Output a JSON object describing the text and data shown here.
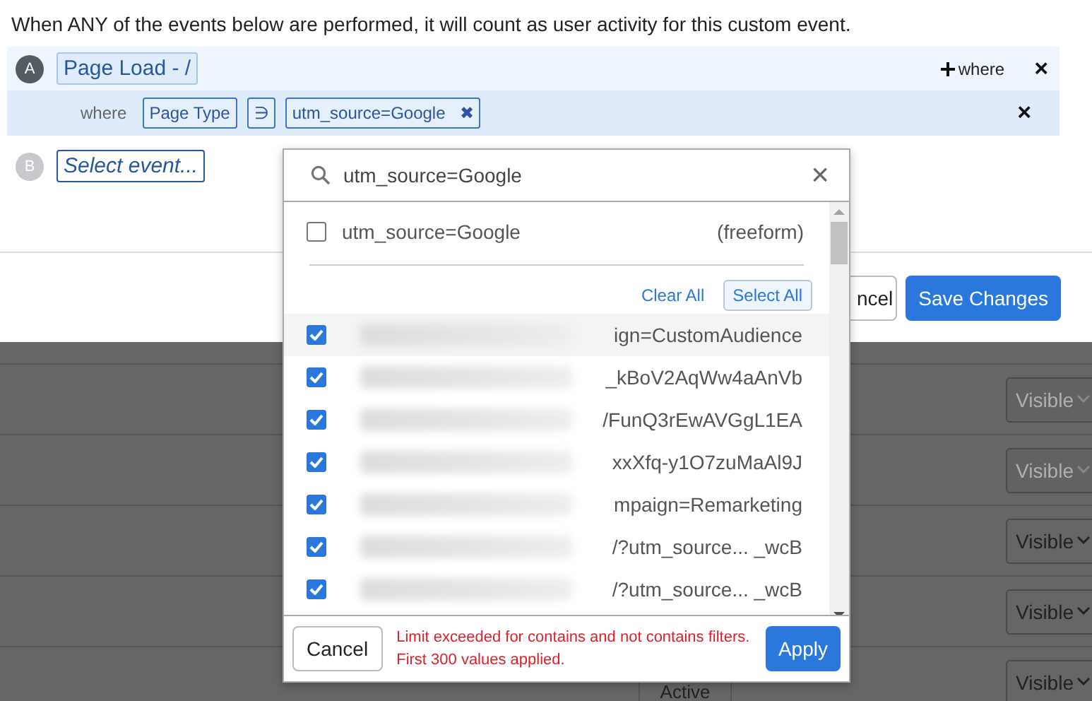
{
  "intro": "When ANY of the events below are performed, it will count as user activity for this custom event.",
  "events": [
    {
      "letter": "A",
      "kind": "set",
      "name": "Page Load - /",
      "add_where": "where",
      "remove": "×",
      "filters": [
        {
          "prefix": "where",
          "property": "Page Type",
          "operator": "∋",
          "values": [
            {
              "label": "utm_source=Google",
              "remove": "✖"
            }
          ],
          "remove": "×"
        }
      ]
    },
    {
      "letter": "B",
      "kind": "empty",
      "name": "Select event..."
    }
  ],
  "footer_buttons": [
    {
      "label": "ncel",
      "kind": "secondary"
    },
    {
      "label": "Save Changes",
      "kind": "primary"
    }
  ],
  "background_rows": [
    {
      "status": "Visible",
      "disabled": true
    },
    {
      "status": "Visible",
      "disabled": true
    },
    {
      "status": "Visible",
      "disabled": false
    },
    {
      "status": "Visible",
      "disabled": false
    },
    {
      "status": "Visible",
      "disabled": false,
      "state": "Active"
    }
  ],
  "dropdown": {
    "search": "utm_source=Google",
    "clear": "×",
    "freeform": {
      "label": "utm_source=Google",
      "tag": "(freeform)",
      "checked": false
    },
    "clear_all": "Clear All",
    "select_all": "Select All",
    "options": [
      {
        "text": "ign=CustomAudience",
        "checked": true,
        "highlighted": true
      },
      {
        "text": "_kBoV2AqWw4aAnVb",
        "checked": true,
        "highlighted": false
      },
      {
        "text": "/FunQ3rEwAVGgL1EA",
        "checked": true,
        "highlighted": false
      },
      {
        "text": "xxXfq-y1O7zuMaAl9J",
        "checked": true,
        "highlighted": false
      },
      {
        "text": "mpaign=Remarketing",
        "checked": true,
        "highlighted": false
      },
      {
        "text": "/?utm_source... _wcB",
        "checked": true,
        "highlighted": false
      },
      {
        "text": "/?utm_source... _wcB",
        "checked": true,
        "highlighted": false
      }
    ],
    "cancel": "Cancel",
    "message": "Limit exceeded for contains and not contains filters. First 300 values applied.",
    "apply": "Apply"
  }
}
